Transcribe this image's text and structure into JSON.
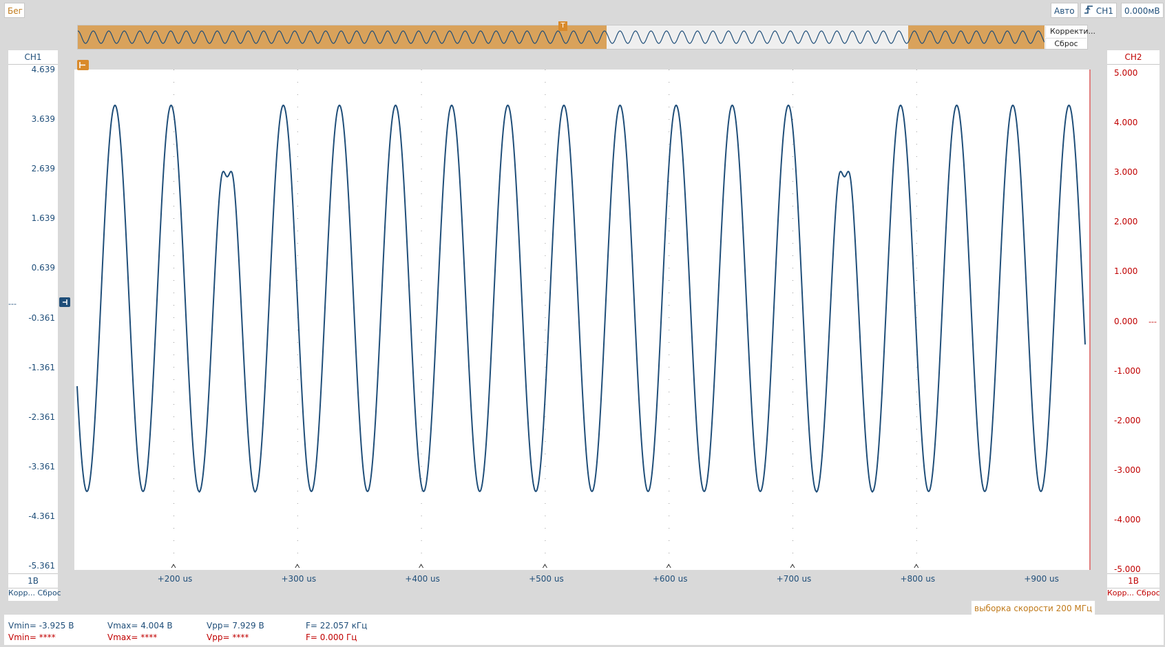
{
  "toolbar": {
    "run_label": "Бег",
    "mode_label": "Авто",
    "trigger_source_label": "CH1",
    "trigger_level_label": "0.000мВ"
  },
  "overview": {
    "correct_label": "Корректи...",
    "reset_label": "Сброс",
    "trigger_marker": "T"
  },
  "ch1": {
    "name": "CH1",
    "scale": "1В",
    "footer": "Корр... Сброс",
    "color": "#1f4e79",
    "ticks": [
      "4.639",
      "3.639",
      "2.639",
      "1.639",
      "0.639",
      "-0.361",
      "-1.361",
      "-2.361",
      "-3.361",
      "-4.361",
      "-5.361"
    ],
    "ground_marker": "---"
  },
  "ch2": {
    "name": "CH2",
    "scale": "1В",
    "footer": "Корр... Сброс",
    "color": "#c00000",
    "ticks": [
      "5.000",
      "4.000",
      "3.000",
      "2.000",
      "1.000",
      "0.000",
      "-1.000",
      "-2.000",
      "-3.000",
      "-4.000",
      "-5.000"
    ],
    "ground_marker": "---"
  },
  "time_axis": {
    "ticks": [
      "+200 us",
      "+300 us",
      "+400 us",
      "+500 us",
      "+600 us",
      "+700 us",
      "+800 us",
      "+900 us"
    ]
  },
  "sample_rate_label": "выборка скорости 200 МГц",
  "measurements": {
    "ch1": {
      "vmin": "Vmin= -3.925 В",
      "vmax": "Vmax= 4.004 В",
      "vpp": "Vpp= 7.929 В",
      "freq": "F= 22.057 кГц"
    },
    "ch2": {
      "vmin": "Vmin= ****",
      "vmax": "Vmax= ****",
      "vpp": "Vpp= ****",
      "freq": "F= 0.000 Гц"
    }
  },
  "colors": {
    "ch1": "#1f4e79",
    "ch2": "#c00000",
    "accent": "#d9a25b"
  }
}
